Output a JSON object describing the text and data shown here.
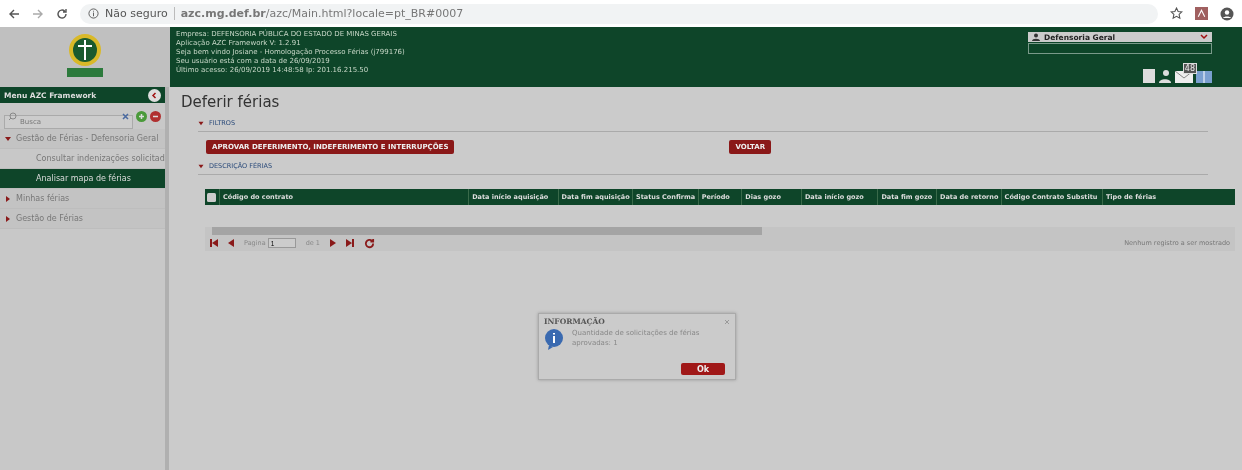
{
  "browser": {
    "security": "Não seguro",
    "url": "**azc.mg.def.br**/azc/Main.html?locale=pt_BR#0007"
  },
  "header": {
    "info_lines": [
      "Empresa: DEFENSORIA PÚBLICA DO ESTADO DE MINAS GERAIS",
      "Aplicação AZC Framework V: 1.2.91",
      "Seja bem vindo Josiane - Homologação Processo Férias (j799176)",
      "Seu usuário está com a data de 26/09/2019",
      "Último acesso: 26/09/2019 14:48:58 Ip: 201.16.215.50"
    ],
    "profile": "Defensoria Geral",
    "mail_count": "48"
  },
  "sidebar": {
    "title": "Menu AZC Framework",
    "search": {
      "placeholder": "Busca"
    },
    "items": [
      {
        "label": "Gestão de Férias - Defensoria Geral",
        "expanded": true,
        "selected": false,
        "children": [
          {
            "label": "Consultar indenizações solicitad",
            "selected": false
          },
          {
            "label": "Analisar mapa de férias",
            "selected": true
          }
        ]
      },
      {
        "label": "Minhas férias",
        "expanded": false,
        "selected": false
      },
      {
        "label": "Gestão de Férias",
        "expanded": false,
        "selected": false
      }
    ]
  },
  "page": {
    "title": "Deferir férias",
    "filters": {
      "label": "FILTROS",
      "expanded": true,
      "buttons": [
        "APROVAR DEFERIMENTO, INDEFERIMENTO E INTERRUPÇÕES",
        "VOLTAR"
      ]
    },
    "section": {
      "label": "DESCRIÇÃO FÉRIAS",
      "expanded": true
    },
    "table": {
      "columns": [
        "Código do contrato",
        "Data início aquisição",
        "Data fim aquisição",
        "Status Confirma",
        "Período",
        "Dias gozo",
        "Data início gozo",
        "Data fim gozo",
        "Data de retorno",
        "Código Contrato Substitu",
        "Tipo de férias"
      ]
    },
    "pager": {
      "page_label": "Pagina",
      "page": "1",
      "of": "de 1",
      "status": "Nenhum registro a ser mostrado"
    }
  },
  "dialog": {
    "title": "INFORMAÇÃO",
    "message": "Quantidade de solicitações de férias aprovadas: 1",
    "button": "Ok"
  }
}
